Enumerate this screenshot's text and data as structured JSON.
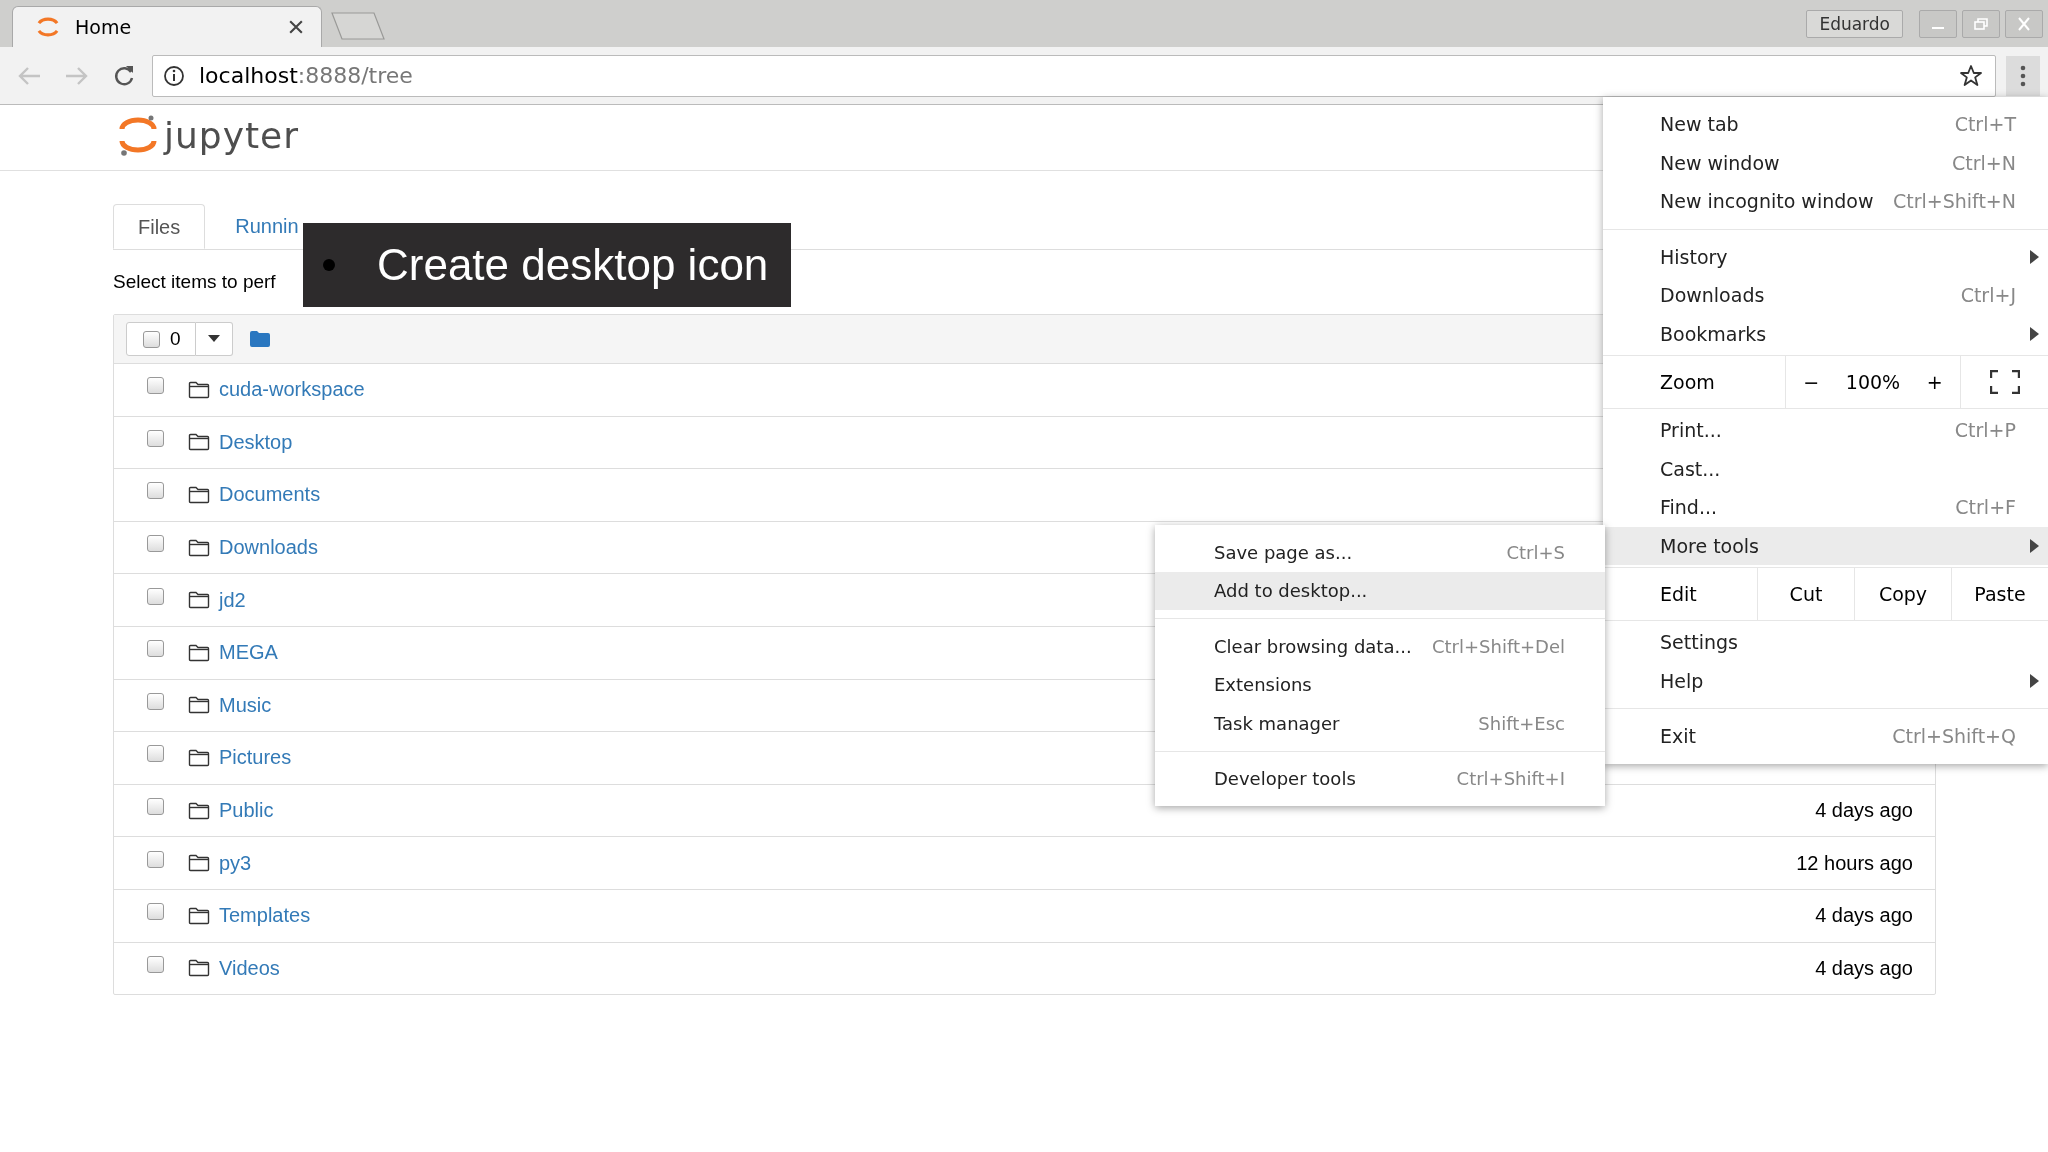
{
  "browser": {
    "tab": {
      "title": "Home"
    },
    "profile": "Eduardo",
    "address": {
      "host": "localhost",
      "path": ":8888/tree"
    }
  },
  "page": {
    "logo_text": "jupyter",
    "tabs": [
      {
        "label": "Files",
        "selected": true
      },
      {
        "label": "Runnin",
        "selected": false
      }
    ],
    "hint": "Select items to perf",
    "toolbar": {
      "selected_count": "0"
    },
    "rows": [
      {
        "name": "cuda-workspace",
        "checked": false
      },
      {
        "name": "Desktop",
        "checked": false
      },
      {
        "name": "Documents",
        "checked": false
      },
      {
        "name": "Downloads",
        "checked": false
      },
      {
        "name": "jd2",
        "checked": false
      },
      {
        "name": "MEGA",
        "checked": false
      },
      {
        "name": "Music",
        "checked": false
      },
      {
        "name": "Pictures",
        "checked": false
      },
      {
        "name": "Public",
        "modified": "4 days ago",
        "checked": false
      },
      {
        "name": "py3",
        "modified": "12 hours ago",
        "checked": false
      },
      {
        "name": "Templates",
        "modified": "4 days ago",
        "checked": false
      },
      {
        "name": "Videos",
        "modified": "4 days ago",
        "checked": false
      }
    ]
  },
  "main_menu": [
    {
      "kind": "item",
      "label": "New tab",
      "shortcut": "Ctrl+T",
      "submenu": false,
      "selected": false
    },
    {
      "kind": "item",
      "label": "New window",
      "shortcut": "Ctrl+N",
      "submenu": false,
      "selected": false
    },
    {
      "kind": "item",
      "label": "New incognito window",
      "shortcut": "Ctrl+Shift+N",
      "submenu": false,
      "selected": false
    },
    {
      "kind": "separator"
    },
    {
      "kind": "item",
      "label": "History",
      "submenu": true,
      "selected": false
    },
    {
      "kind": "item",
      "label": "Downloads",
      "shortcut": "Ctrl+J",
      "submenu": false,
      "selected": false
    },
    {
      "kind": "item",
      "label": "Bookmarks",
      "submenu": true,
      "selected": false
    },
    {
      "kind": "zoom",
      "label": "Zoom",
      "minus": "−",
      "value": "100%",
      "plus": "+"
    },
    {
      "kind": "item",
      "label": "Print...",
      "shortcut": "Ctrl+P",
      "submenu": false,
      "selected": false
    },
    {
      "kind": "item",
      "label": "Cast...",
      "submenu": false,
      "selected": false
    },
    {
      "kind": "item",
      "label": "Find...",
      "shortcut": "Ctrl+F",
      "submenu": false,
      "selected": false
    },
    {
      "kind": "item",
      "label": "More tools",
      "submenu": true,
      "selected": true
    },
    {
      "kind": "edit",
      "label": "Edit",
      "buttons": [
        "Cut",
        "Copy",
        "Paste"
      ]
    },
    {
      "kind": "item",
      "label": "Settings",
      "submenu": false,
      "selected": false
    },
    {
      "kind": "item",
      "label": "Help",
      "submenu": true,
      "selected": false
    },
    {
      "kind": "separator"
    },
    {
      "kind": "item",
      "label": "Exit",
      "shortcut": "Ctrl+Shift+Q",
      "submenu": false,
      "selected": false
    }
  ],
  "submenu": [
    {
      "kind": "item",
      "label": "Save page as...",
      "shortcut": "Ctrl+S",
      "selected": false
    },
    {
      "kind": "item",
      "label": "Add to desktop...",
      "selected": true
    },
    {
      "kind": "separator"
    },
    {
      "kind": "item",
      "label": "Clear browsing data...",
      "shortcut": "Ctrl+Shift+Del",
      "selected": false
    },
    {
      "kind": "item",
      "label": "Extensions",
      "selected": false
    },
    {
      "kind": "item",
      "label": "Task manager",
      "shortcut": "Shift+Esc",
      "selected": false
    },
    {
      "kind": "separator"
    },
    {
      "kind": "item",
      "label": "Developer tools",
      "shortcut": "Ctrl+Shift+I",
      "selected": false
    }
  ],
  "caption": {
    "text": "Create desktop icon"
  }
}
